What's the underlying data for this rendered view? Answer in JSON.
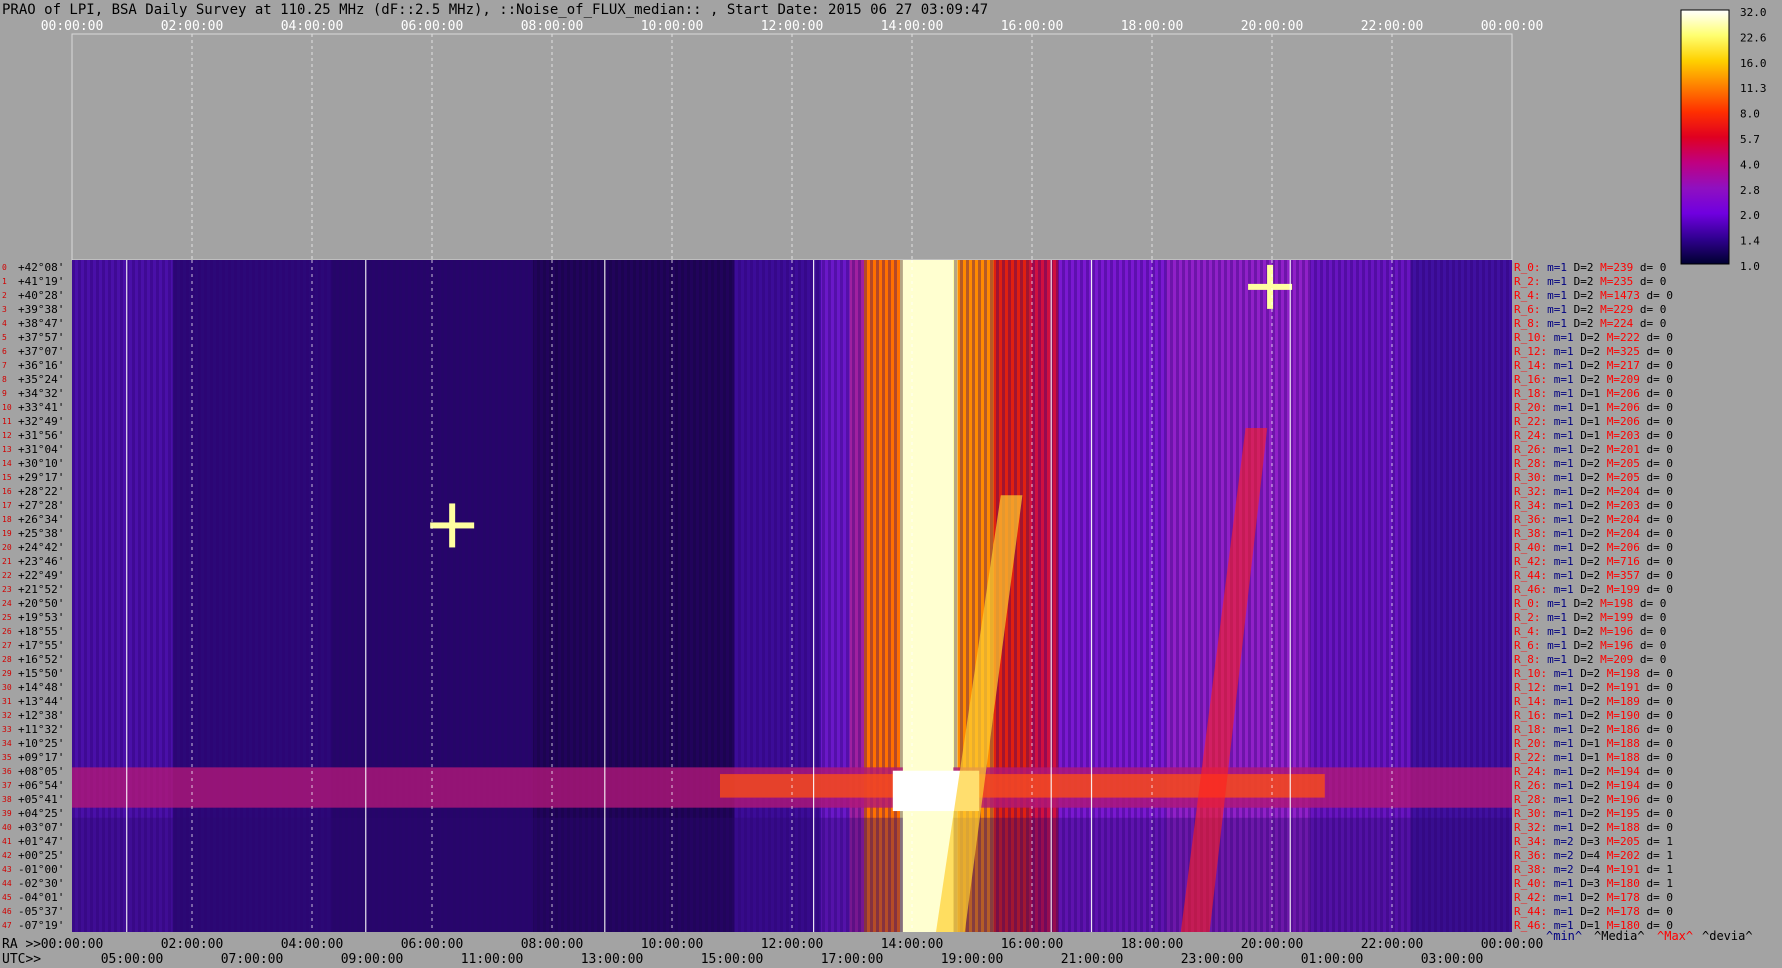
{
  "title": "PRAO of LPI, BSA Daily Survey at 110.25 MHz (dF::2.5 MHz), ::Noise_of_FLUX_median:: , Start Date: 2015 06 27 03:09:47",
  "axes": {
    "ra_label": "RA >>",
    "utc_label": "UTC>>",
    "top_ticks": [
      "00:00:00",
      "02:00:00",
      "04:00:00",
      "06:00:00",
      "08:00:00",
      "10:00:00",
      "12:00:00",
      "14:00:00",
      "16:00:00",
      "18:00:00",
      "20:00:00",
      "22:00:00",
      "00:00:00"
    ],
    "bottom_ra_ticks": [
      "00:00:00",
      "02:00:00",
      "04:00:00",
      "06:00:00",
      "08:00:00",
      "10:00:00",
      "12:00:00",
      "14:00:00",
      "16:00:00",
      "18:00:00",
      "20:00:00",
      "22:00:00",
      "00:00:00"
    ],
    "bottom_utc_ticks": [
      "05:00:00",
      "07:00:00",
      "09:00:00",
      "11:00:00",
      "13:00:00",
      "15:00:00",
      "17:00:00",
      "19:00:00",
      "21:00:00",
      "23:00:00",
      "01:00:00",
      "03:00:00"
    ]
  },
  "colorbar": {
    "labels": [
      "32.0",
      "22.6",
      "16.0",
      "11.3",
      "8.0",
      "5.7",
      "4.0",
      "2.8",
      "2.0",
      "1.4",
      "1.0"
    ],
    "stops": [
      "#ffffff",
      "#ffff70",
      "#ffd000",
      "#ff8000",
      "#ff3000",
      "#e00020",
      "#c00080",
      "#9010c0",
      "#7000e0",
      "#300090",
      "#000030"
    ]
  },
  "legend": {
    "min": "^min^",
    "media": "^Media^",
    "max": "^Max^",
    "devia": "^devia^",
    "colors": {
      "min": "#000080",
      "media": "#000000",
      "max": "#ff0000",
      "devia": "#000000"
    }
  },
  "chart_data": {
    "type": "heatmap",
    "title": "PRAO of LPI, BSA Daily Survey at 110.25 MHz (dF::2.5 MHz), ::Noise_of_FLUX_median:: , Start Date: 2015 06 27 03:09:47",
    "x_axis_ra": [
      "00:00:00",
      "02:00:00",
      "04:00:00",
      "06:00:00",
      "08:00:00",
      "10:00:00",
      "12:00:00",
      "14:00:00",
      "16:00:00",
      "18:00:00",
      "20:00:00",
      "22:00:00",
      "00:00:00"
    ],
    "x_axis_utc": [
      "05:00:00",
      "07:00:00",
      "09:00:00",
      "11:00:00",
      "13:00:00",
      "15:00:00",
      "17:00:00",
      "19:00:00",
      "21:00:00",
      "23:00:00",
      "01:00:00",
      "03:00:00"
    ],
    "colorscale": [
      32.0,
      22.6,
      16.0,
      11.3,
      8.0,
      5.7,
      4.0,
      2.8,
      2.0,
      1.4,
      1.0
    ],
    "declinations": [
      "+42°08'",
      "+41°19'",
      "+40°28'",
      "+39°38'",
      "+38°47'",
      "+37°57'",
      "+37°07'",
      "+36°16'",
      "+35°24'",
      "+34°32'",
      "+33°41'",
      "+32°49'",
      "+31°56'",
      "+31°04'",
      "+30°10'",
      "+29°17'",
      "+28°22'",
      "+27°28'",
      "+26°34'",
      "+25°38'",
      "+24°42'",
      "+23°46'",
      "+22°49'",
      "+21°52'",
      "+20°50'",
      "+19°53'",
      "+18°55'",
      "+17°55'",
      "+16°52'",
      "+15°50'",
      "+14°48'",
      "+13°44'",
      "+12°38'",
      "+11°32'",
      "+10°25'",
      "+09°17'",
      "+08°05'",
      "+06°54'",
      "+05°41'",
      "+04°25'",
      "+03°07'",
      "+01°47'",
      "+00°25'",
      "-01°00'",
      "-02°30'",
      "-04°01'",
      "-05°37'",
      "-07°19'"
    ],
    "row_numbers": [
      "0",
      "1",
      "2",
      "3",
      "4",
      "5",
      "6",
      "7",
      "8",
      "9",
      "10",
      "11",
      "12",
      "13",
      "14",
      "15",
      "16",
      "17",
      "18",
      "19",
      "20",
      "21",
      "22",
      "23",
      "24",
      "25",
      "26",
      "27",
      "28",
      "29",
      "30",
      "31",
      "32",
      "33",
      "34",
      "35",
      "36",
      "37",
      "38",
      "39",
      "40",
      "41",
      "42",
      "43",
      "44",
      "45",
      "46",
      "47"
    ],
    "stats": [
      {
        "r": "R_0:",
        "m": "m=1",
        "D": "D=2",
        "M": "M=239",
        "d": "d= 0"
      },
      {
        "r": "R_2:",
        "m": "m=1",
        "D": "D=2",
        "M": "M=235",
        "d": "d= 0"
      },
      {
        "r": "R_4:",
        "m": "m=1",
        "D": "D=2",
        "M": "M=1473",
        "d": "d= 0"
      },
      {
        "r": "R_6:",
        "m": "m=1",
        "D": "D=2",
        "M": "M=229",
        "d": "d= 0"
      },
      {
        "r": "R_8:",
        "m": "m=1",
        "D": "D=2",
        "M": "M=224",
        "d": "d= 0"
      },
      {
        "r": "R_10:",
        "m": "m=1",
        "D": "D=2",
        "M": "M=222",
        "d": "d= 0"
      },
      {
        "r": "R_12:",
        "m": "m=1",
        "D": "D=2",
        "M": "M=325",
        "d": "d= 0"
      },
      {
        "r": "R_14:",
        "m": "m=1",
        "D": "D=2",
        "M": "M=217",
        "d": "d= 0"
      },
      {
        "r": "R_16:",
        "m": "m=1",
        "D": "D=2",
        "M": "M=209",
        "d": "d= 0"
      },
      {
        "r": "R_18:",
        "m": "m=1",
        "D": "D=1",
        "M": "M=206",
        "d": "d= 0"
      },
      {
        "r": "R_20:",
        "m": "m=1",
        "D": "D=1",
        "M": "M=206",
        "d": "d= 0"
      },
      {
        "r": "R_22:",
        "m": "m=1",
        "D": "D=1",
        "M": "M=206",
        "d": "d= 0"
      },
      {
        "r": "R_24:",
        "m": "m=1",
        "D": "D=1",
        "M": "M=203",
        "d": "d= 0"
      },
      {
        "r": "R_26:",
        "m": "m=1",
        "D": "D=2",
        "M": "M=201",
        "d": "d= 0"
      },
      {
        "r": "R_28:",
        "m": "m=1",
        "D": "D=2",
        "M": "M=205",
        "d": "d= 0"
      },
      {
        "r": "R_30:",
        "m": "m=1",
        "D": "D=2",
        "M": "M=205",
        "d": "d= 0"
      },
      {
        "r": "R_32:",
        "m": "m=1",
        "D": "D=2",
        "M": "M=204",
        "d": "d= 0"
      },
      {
        "r": "R_34:",
        "m": "m=1",
        "D": "D=2",
        "M": "M=203",
        "d": "d= 0"
      },
      {
        "r": "R_36:",
        "m": "m=1",
        "D": "D=2",
        "M": "M=204",
        "d": "d= 0"
      },
      {
        "r": "R_38:",
        "m": "m=1",
        "D": "D=2",
        "M": "M=204",
        "d": "d= 0"
      },
      {
        "r": "R_40:",
        "m": "m=1",
        "D": "D=2",
        "M": "M=206",
        "d": "d= 0"
      },
      {
        "r": "R_42:",
        "m": "m=1",
        "D": "D=2",
        "M": "M=716",
        "d": "d= 0"
      },
      {
        "r": "R_44:",
        "m": "m=1",
        "D": "D=2",
        "M": "M=357",
        "d": "d= 0"
      },
      {
        "r": "R_46:",
        "m": "m=1",
        "D": "D=2",
        "M": "M=199",
        "d": "d= 0"
      },
      {
        "r": "R_0:",
        "m": "m=1",
        "D": "D=2",
        "M": "M=198",
        "d": "d= 0"
      },
      {
        "r": "R_2:",
        "m": "m=1",
        "D": "D=2",
        "M": "M=199",
        "d": "d= 0"
      },
      {
        "r": "R_4:",
        "m": "m=1",
        "D": "D=2",
        "M": "M=196",
        "d": "d= 0"
      },
      {
        "r": "R_6:",
        "m": "m=1",
        "D": "D=2",
        "M": "M=196",
        "d": "d= 0"
      },
      {
        "r": "R_8:",
        "m": "m=1",
        "D": "D=2",
        "M": "M=209",
        "d": "d= 0"
      },
      {
        "r": "R_10:",
        "m": "m=1",
        "D": "D=2",
        "M": "M=198",
        "d": "d= 0"
      },
      {
        "r": "R_12:",
        "m": "m=1",
        "D": "D=2",
        "M": "M=191",
        "d": "d= 0"
      },
      {
        "r": "R_14:",
        "m": "m=1",
        "D": "D=2",
        "M": "M=189",
        "d": "d= 0"
      },
      {
        "r": "R_16:",
        "m": "m=1",
        "D": "D=2",
        "M": "M=190",
        "d": "d= 0"
      },
      {
        "r": "R_18:",
        "m": "m=1",
        "D": "D=2",
        "M": "M=186",
        "d": "d= 0"
      },
      {
        "r": "R_20:",
        "m": "m=1",
        "D": "D=1",
        "M": "M=188",
        "d": "d= 0"
      },
      {
        "r": "R_22:",
        "m": "m=1",
        "D": "D=1",
        "M": "M=188",
        "d": "d= 0"
      },
      {
        "r": "R_24:",
        "m": "m=1",
        "D": "D=2",
        "M": "M=194",
        "d": "d= 0"
      },
      {
        "r": "R_26:",
        "m": "m=1",
        "D": "D=2",
        "M": "M=194",
        "d": "d= 0"
      },
      {
        "r": "R_28:",
        "m": "m=1",
        "D": "D=2",
        "M": "M=196",
        "d": "d= 0"
      },
      {
        "r": "R_30:",
        "m": "m=1",
        "D": "D=2",
        "M": "M=195",
        "d": "d= 0"
      },
      {
        "r": "R_32:",
        "m": "m=1",
        "D": "D=2",
        "M": "M=188",
        "d": "d= 0"
      },
      {
        "r": "R_34:",
        "m": "m=2",
        "D": "D=3",
        "M": "M=205",
        "d": "d= 1"
      },
      {
        "r": "R_36:",
        "m": "m=2",
        "D": "D=4",
        "M": "M=202",
        "d": "d= 1"
      },
      {
        "r": "R_38:",
        "m": "m=2",
        "D": "D=4",
        "M": "M=191",
        "d": "d= 1"
      },
      {
        "r": "R_40:",
        "m": "m=1",
        "D": "D=3",
        "M": "M=180",
        "d": "d= 1"
      },
      {
        "r": "R_42:",
        "m": "m=1",
        "D": "D=2",
        "M": "M=178",
        "d": "d= 0"
      },
      {
        "r": "R_44:",
        "m": "m=1",
        "D": "D=2",
        "M": "M=178",
        "d": "d= 0"
      },
      {
        "r": "R_46:",
        "m": "m=1",
        "D": "D=1",
        "M": "M=180",
        "d": "d= 0"
      }
    ]
  }
}
